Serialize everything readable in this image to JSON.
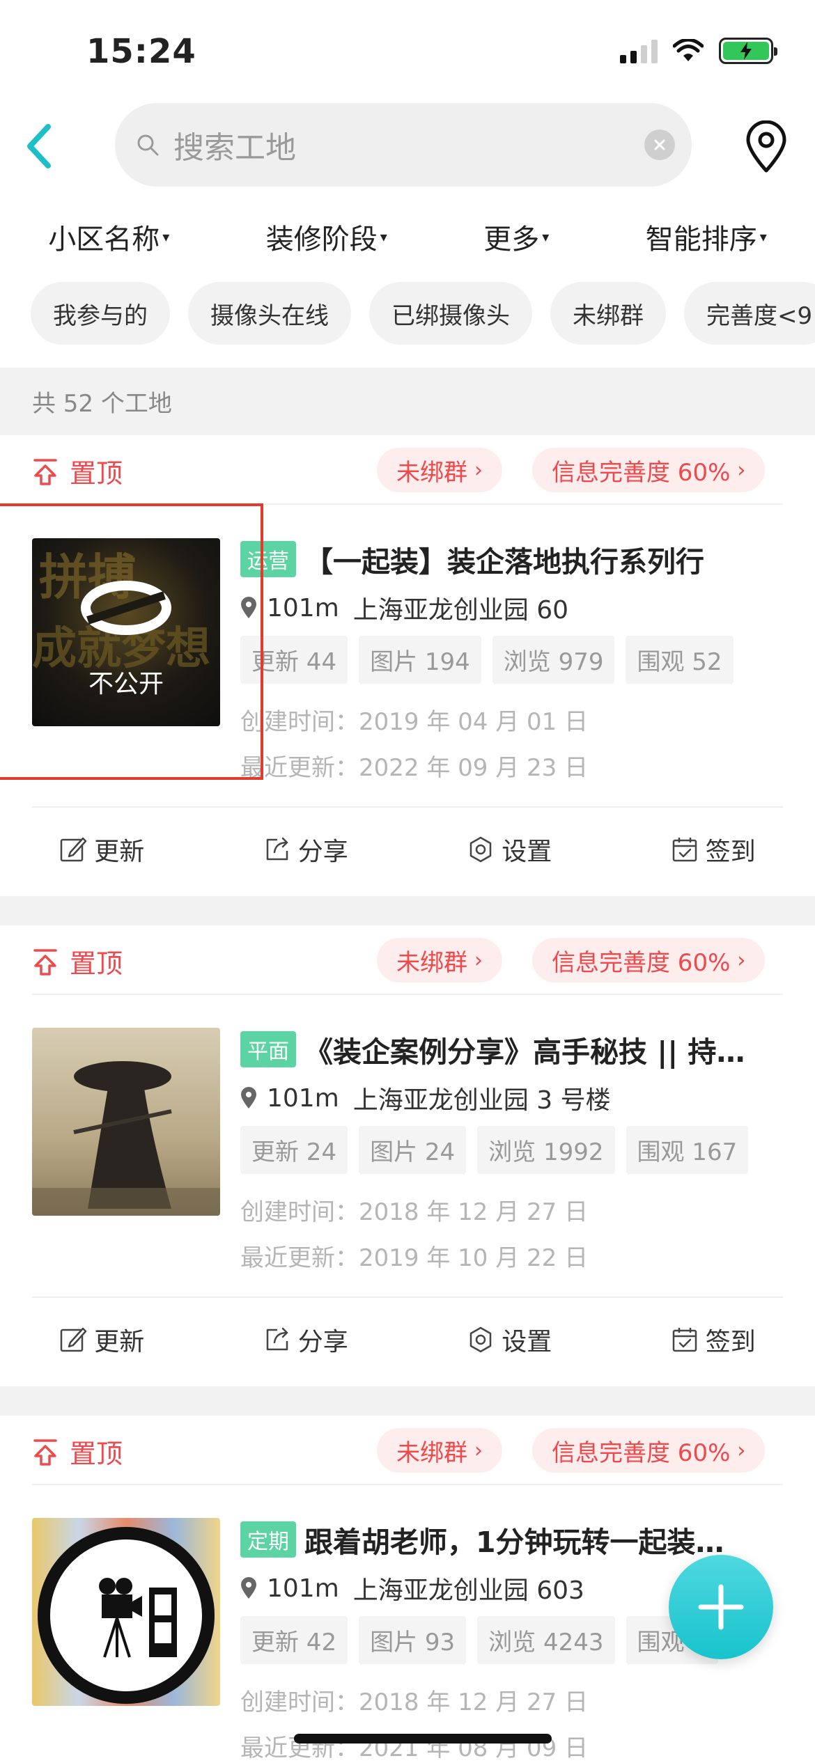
{
  "status": {
    "time": "15:24"
  },
  "colors": {
    "accent": "#1dbfc8",
    "pin": "#f0494d",
    "tag": "#5cd3a2",
    "battery": "#33c759"
  },
  "header": {
    "back_icon": "chevron-left-icon",
    "search_placeholder": "搜索工地",
    "location_icon": "location-pin-icon"
  },
  "filters": [
    "小区名称",
    "装修阶段",
    "更多",
    "智能排序"
  ],
  "chips": [
    "我参与的",
    "摄像头在线",
    "已绑摄像头",
    "未绑群",
    "完善度<9"
  ],
  "count_text": "共 52 个工地",
  "cards": [
    {
      "pin_label": "置顶",
      "group_pill": "未绑群",
      "info_pill": "信息完善度 60%",
      "tag": "运营",
      "title": "【一起装】装企落地执行系列行",
      "distance": "101m",
      "location": "上海亚龙创业园  60",
      "stats": [
        "更新 44",
        "图片 194",
        "浏览 979",
        "围观 52"
      ],
      "created_label": "创建时间：",
      "created": "2019 年 04 月 01 日",
      "updated_label": "最近更新：",
      "updated": "2022 年 09 月 23 日",
      "thumb_overlay": "不公开",
      "actions": [
        "更新",
        "分享",
        "设置",
        "签到"
      ]
    },
    {
      "pin_label": "置顶",
      "group_pill": "未绑群",
      "info_pill": "信息完善度 60%",
      "tag": "平面",
      "title": "《装企案例分享》高手秘技 || 持…",
      "distance": "101m",
      "location": "上海亚龙创业园  3 号楼",
      "stats": [
        "更新 24",
        "图片 24",
        "浏览 1992",
        "围观 167"
      ],
      "created_label": "创建时间：",
      "created": "2018 年 12 月 27 日",
      "updated_label": "最近更新：",
      "updated": "2019 年 10 月 22 日",
      "actions": [
        "更新",
        "分享",
        "设置",
        "签到"
      ]
    },
    {
      "pin_label": "置顶",
      "group_pill": "未绑群",
      "info_pill": "信息完善度 60%",
      "tag": "定期",
      "title": "跟着胡老师，1分钟玩转一起装…",
      "distance": "101m",
      "location": "上海亚龙创业园  603",
      "stats": [
        "更新 42",
        "图片 93",
        "浏览 4243",
        "围观 3"
      ],
      "created_label": "创建时间：",
      "created": "2018 年 12 月 27 日",
      "updated_label": "最近更新：",
      "updated": "2021 年 08 月 09 日"
    }
  ],
  "fab_icon": "plus-icon"
}
